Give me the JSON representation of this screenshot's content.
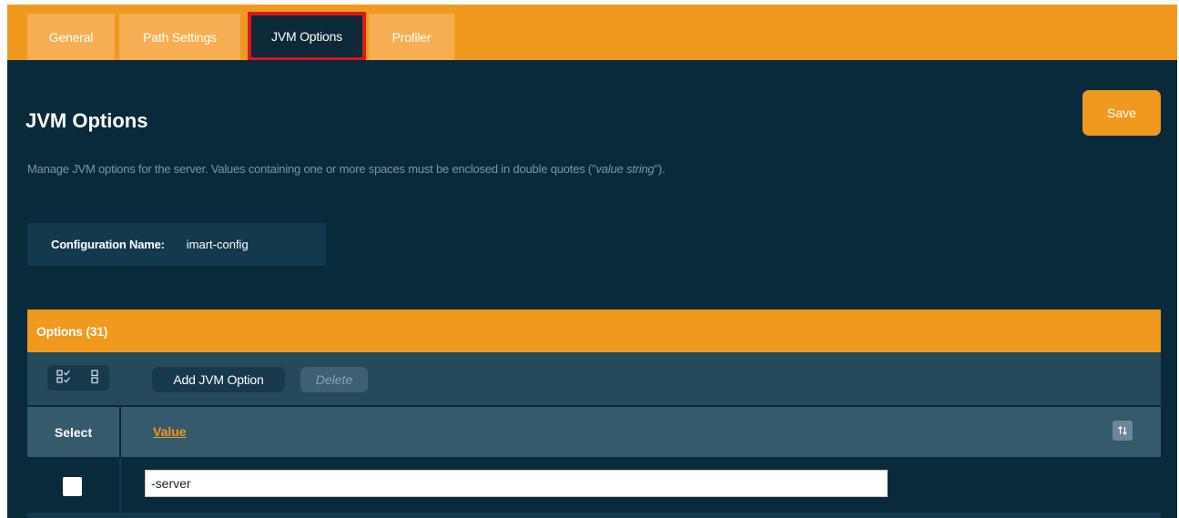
{
  "tabs": [
    {
      "label": "General"
    },
    {
      "label": "Path Settings"
    },
    {
      "label": "JVM Options"
    },
    {
      "label": "Profiler"
    }
  ],
  "page": {
    "title": "JVM Options",
    "save_label": "Save",
    "description": "Manage JVM options for the server. Values containing one or more spaces must be enclosed in double quotes (\"",
    "description_em": "value string",
    "description_end": "\")."
  },
  "config": {
    "label": "Configuration Name:",
    "value": "imart-config"
  },
  "options": {
    "header": "Options (31)",
    "toolbar": {
      "select_all_icon": "check-all-icon",
      "deselect_icon": "uncheck-all-icon",
      "add_label": "Add JVM Option",
      "delete_label": "Delete"
    },
    "columns": {
      "select": "Select",
      "value": "Value",
      "sort_icon": "sort-arrows-icon"
    },
    "rows": [
      {
        "checked": false,
        "value": "-server"
      }
    ]
  },
  "colors": {
    "accent": "#f0991f",
    "background": "#092a3b",
    "active_tab_outline": "#d9181a"
  }
}
